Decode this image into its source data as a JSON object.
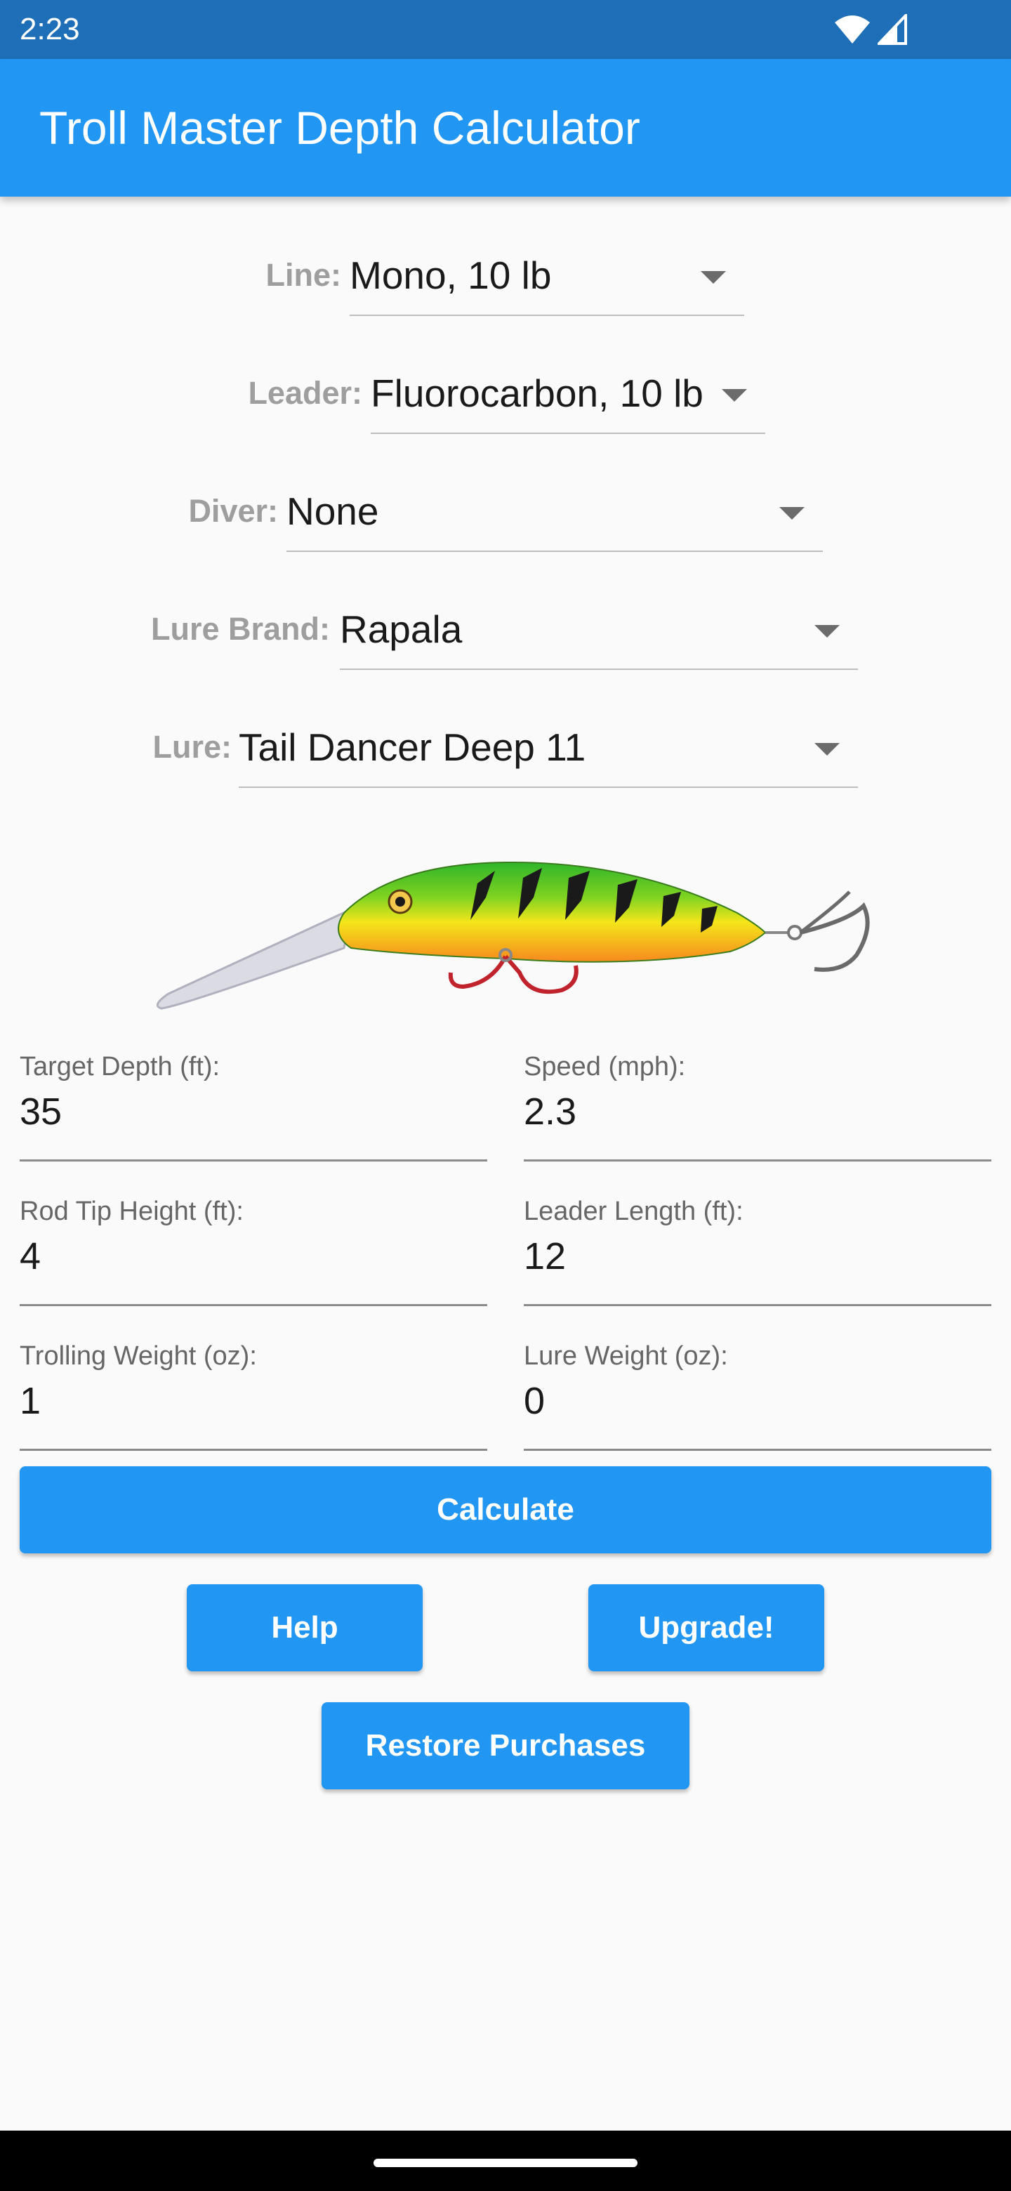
{
  "status_bar": {
    "time": "2:23",
    "icons": [
      "wifi-icon",
      "cell-signal-icon"
    ]
  },
  "app_bar": {
    "title": "Troll Master Depth Calculator",
    "color": "#2196f3"
  },
  "dropdowns": [
    {
      "label": "Line:",
      "value": "Mono, 10 lb"
    },
    {
      "label": "Leader:",
      "value": "Fluorocarbon, 10 lb"
    },
    {
      "label": "Diver:",
      "value": "None"
    },
    {
      "label": "Lure Brand:",
      "value": "Rapala"
    },
    {
      "label": "Lure:",
      "value": "Tail Dancer Deep 11"
    }
  ],
  "lure_image": {
    "icon": "lure-image",
    "colors": [
      "#2fb52a",
      "#f4e61a",
      "#f7891e",
      "#1a1a1a"
    ]
  },
  "fields": [
    {
      "label": "Target Depth (ft):",
      "value": "35"
    },
    {
      "label": "Speed (mph):",
      "value": "2.3"
    },
    {
      "label": "Rod Tip Height (ft):",
      "value": "4"
    },
    {
      "label": "Leader Length (ft):",
      "value": "12"
    },
    {
      "label": "Trolling Weight (oz):",
      "value": "1"
    },
    {
      "label": "Lure Weight (oz):",
      "value": "0"
    }
  ],
  "buttons": {
    "calculate": "Calculate",
    "help": "Help",
    "upgrade": "Upgrade!",
    "restore": "Restore Purchases"
  },
  "accent_color": "#2196f3"
}
